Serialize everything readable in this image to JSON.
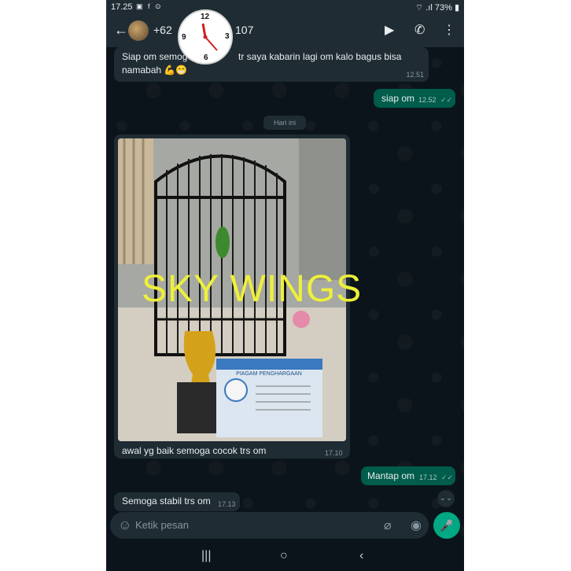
{
  "status_bar": {
    "time": "17.25",
    "notification_icons": "▣ f ⊙",
    "right": "⌔ .ıl 73% ▮"
  },
  "header": {
    "back_icon": "←",
    "contact_name_start": "+62",
    "contact_name_end": "107",
    "video_icon": "▶",
    "call_icon": "✆",
    "menu_icon": "⋮"
  },
  "clock_overlay": {
    "n12": "12",
    "n3": "3",
    "n6": "6",
    "n9": "9"
  },
  "messages": [
    {
      "dir": "in",
      "text_line1_start": "Siap om semog",
      "text_line1_end": "tr saya kabarin lagi om kalo bagus bisa",
      "text_line2": "namabah 💪😁",
      "time": "12.51"
    },
    {
      "dir": "out",
      "text": "siap om",
      "time": "12.52",
      "ticks": "✓✓"
    },
    {
      "dir": "in",
      "caption": "awal yg baik semoga cocok trs om",
      "time": "17.10"
    },
    {
      "dir": "out",
      "text": "Mantap om",
      "time": "17.12",
      "ticks": "✓✓"
    },
    {
      "dir": "in",
      "text": "Semoga stabil trs om",
      "time": "17.13"
    }
  ],
  "date_divider": "Hari ini",
  "photo": {
    "watermark": "SKY WINGS",
    "cert_title": "PIAGAM PENGHARGAAN"
  },
  "composer": {
    "emoji_icon": "☺",
    "placeholder": "Ketik pesan",
    "attach_icon": "⌀",
    "camera_icon": "◉",
    "mic_icon": "🎤"
  },
  "scroll_down_icon": "⌄⌄",
  "nav": {
    "recents": "|||",
    "home": "○",
    "back": "‹"
  }
}
